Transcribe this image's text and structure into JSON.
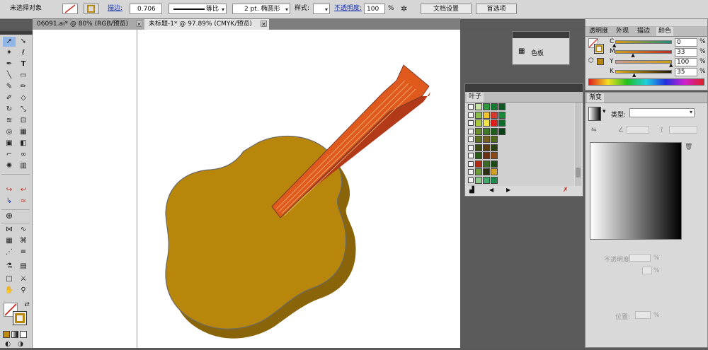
{
  "control_bar": {
    "selection_label": "未选择对象",
    "stroke_label": "描边:",
    "stroke_value": "0.706",
    "profile_label": "等比",
    "brush_label": "2 pt. 椭圆形",
    "style_label": "样式:",
    "opacity_label": "不透明度:",
    "opacity_value": "100",
    "percent": "%",
    "doc_setup_button": "文档设置",
    "preferences_button": "首选项",
    "stroke_color": "#c8342a",
    "fill_color": "#b8860b"
  },
  "tabs": [
    {
      "label": "06091.ai* @ 80% (RGB/预览)"
    },
    {
      "label": "未标题-1* @ 97.89% (CMYK/预览)"
    }
  ],
  "close_glyph": "✕",
  "swatch_mini_panel": {
    "label": "色板"
  },
  "leaves_panel": {
    "title": "叶子",
    "swatch_rows": [
      [
        "#c9e2a8",
        "#2e9a3c",
        "#147a2e",
        "#0d5a24"
      ],
      [
        "#8bbd4a",
        "#f2c230",
        "#d9382a",
        "#19893a"
      ],
      [
        "#a7c83c",
        "#f4e44a",
        "#e21b1b",
        "#0f6b2a"
      ],
      [
        "#6a8c2a",
        "#3d7a23",
        "#1f5e1c",
        "#0b3f14"
      ],
      [
        "#5c7020",
        "#7a6020",
        "#4e6a1a"
      ],
      [
        "#3e4a14",
        "#5a3a10",
        "#2c4010"
      ],
      [
        "#2a5a14",
        "#6a3010",
        "#8a4a18"
      ],
      [
        "#b02a14",
        "#3a6a28",
        "#1f4a18"
      ],
      [
        "#6a9a3a",
        "#2a3010",
        "#d4a020"
      ],
      [
        "#8ec88a",
        "#3fa86a",
        "#1e8a4e"
      ]
    ]
  },
  "color_panel": {
    "tabs": [
      "透明度",
      "外观",
      "描边",
      "颜色"
    ],
    "channels": [
      {
        "name": "C",
        "value": "0",
        "pos": 0.0
      },
      {
        "name": "M",
        "value": "33",
        "pos": 0.33
      },
      {
        "name": "Y",
        "value": "100",
        "pos": 1.0
      },
      {
        "name": "K",
        "value": "35",
        "pos": 0.35
      }
    ],
    "unit": "%"
  },
  "gradient_panel": {
    "title": "渐变",
    "type_label": "类型:",
    "opacity_label": "不透明度:",
    "position_label": "位置:",
    "percent": "%"
  },
  "artwork": {
    "body_color": "#b8860b",
    "body_shadow": "#8a6408",
    "neck_color": "#e05a1e",
    "neck_side": "#b23a18"
  }
}
